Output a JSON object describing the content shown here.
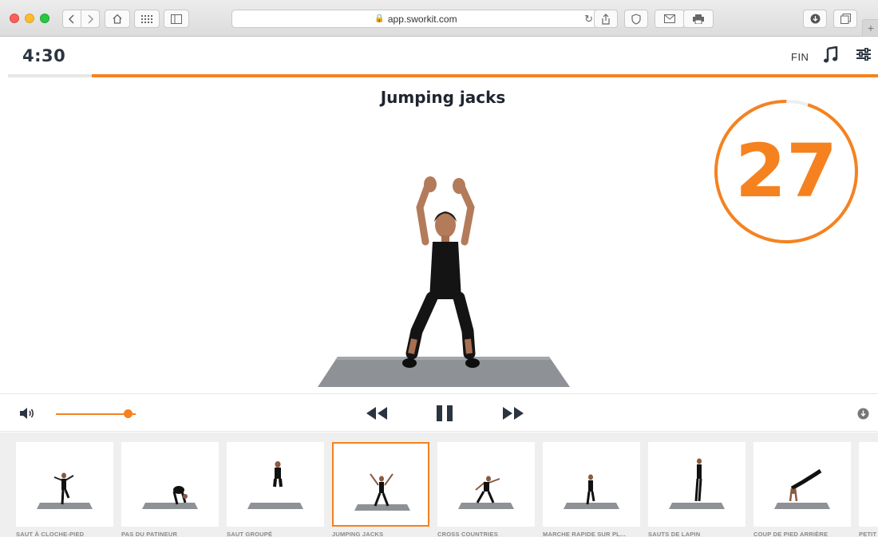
{
  "browser": {
    "url": "app.sworkit.com"
  },
  "header": {
    "timer": "4:30",
    "finish_label": "FIN",
    "progress_fraction": 0.0
  },
  "exercise": {
    "title": "Jumping jacks",
    "count": "27",
    "count_ring_fraction": 0.95
  },
  "controls": {
    "volume_level": 0.9
  },
  "colors": {
    "accent": "#f5821f",
    "dark": "#2b3440"
  },
  "thumbnails": [
    {
      "label": "SAUT À CLOCHE-PIED"
    },
    {
      "label": "PAS DU PATINEUR"
    },
    {
      "label": "SAUT GROUPÉ"
    },
    {
      "label": "JUMPING JACKS",
      "active": true
    },
    {
      "label": "CROSS COUNTRIES"
    },
    {
      "label": "MARCHE RAPIDE SUR PL..."
    },
    {
      "label": "SAUTS DE LAPIN"
    },
    {
      "label": "COUP DE PIED ARRIÈRE"
    },
    {
      "label": "PETIT"
    }
  ]
}
